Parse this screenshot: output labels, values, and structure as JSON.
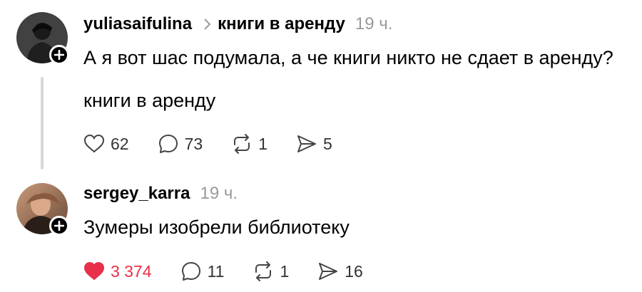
{
  "posts": [
    {
      "username": "yuliasaifulina",
      "topic": "книги в аренду",
      "time": "19 ч.",
      "text": "А я вот шас подумала, а че книги никто не сдает в аренду?",
      "tag": "книги в аренду",
      "likes": "62",
      "comments": "73",
      "reposts": "1",
      "shares": "5",
      "liked": false
    },
    {
      "username": "sergey_karra",
      "time": "19 ч.",
      "text": "Зумеры изобрели библиотеку",
      "likes": "3 374",
      "comments": "11",
      "reposts": "1",
      "shares": "16",
      "liked": true
    }
  ],
  "icons": {
    "like": "heart-icon",
    "comment": "speech-bubble-icon",
    "repost": "repost-arrows-icon",
    "share": "send-arrow-icon",
    "follow": "plus-icon",
    "topic_separator": "chevron-right-icon"
  },
  "colors": {
    "liked": "#e8304a",
    "muted": "#9a9a9a",
    "thread_line": "#d8d8d8"
  }
}
